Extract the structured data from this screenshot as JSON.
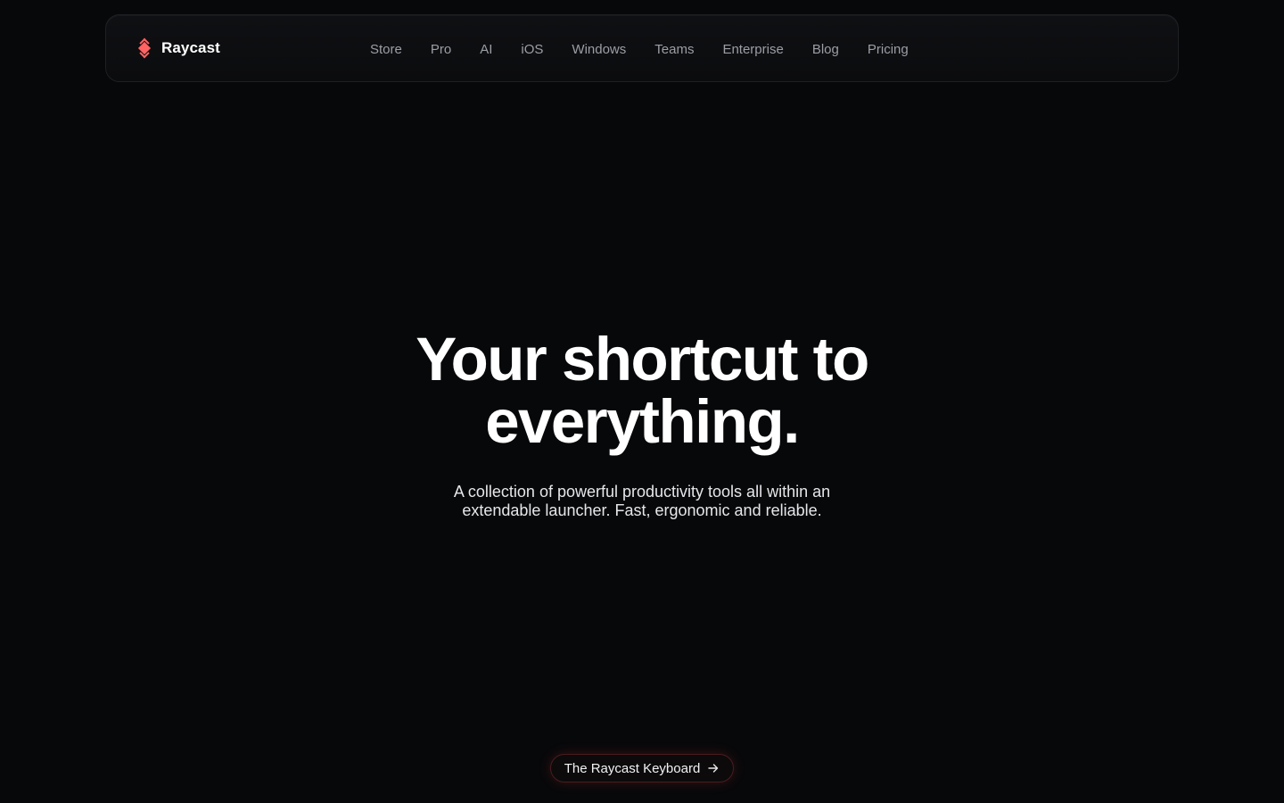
{
  "colors": {
    "background": "#07080a",
    "brand_accent": "#ff6363",
    "nav_text": "#9c9ea6"
  },
  "header": {
    "brand": {
      "name": "Raycast",
      "icon": "raycast-logo-icon"
    },
    "nav": [
      {
        "label": "Store"
      },
      {
        "label": "Pro"
      },
      {
        "label": "AI"
      },
      {
        "label": "iOS"
      },
      {
        "label": "Windows"
      },
      {
        "label": "Teams"
      },
      {
        "label": "Enterprise"
      },
      {
        "label": "Blog"
      },
      {
        "label": "Pricing"
      }
    ]
  },
  "hero": {
    "title_line1": "Your shortcut to",
    "title_line2": "everything.",
    "subtitle_line1": "A collection of powerful productivity tools all within an",
    "subtitle_line2": "extendable launcher. Fast, ergonomic and reliable."
  },
  "cta": {
    "label": "The Raycast Keyboard",
    "icon": "arrow-right-icon"
  }
}
